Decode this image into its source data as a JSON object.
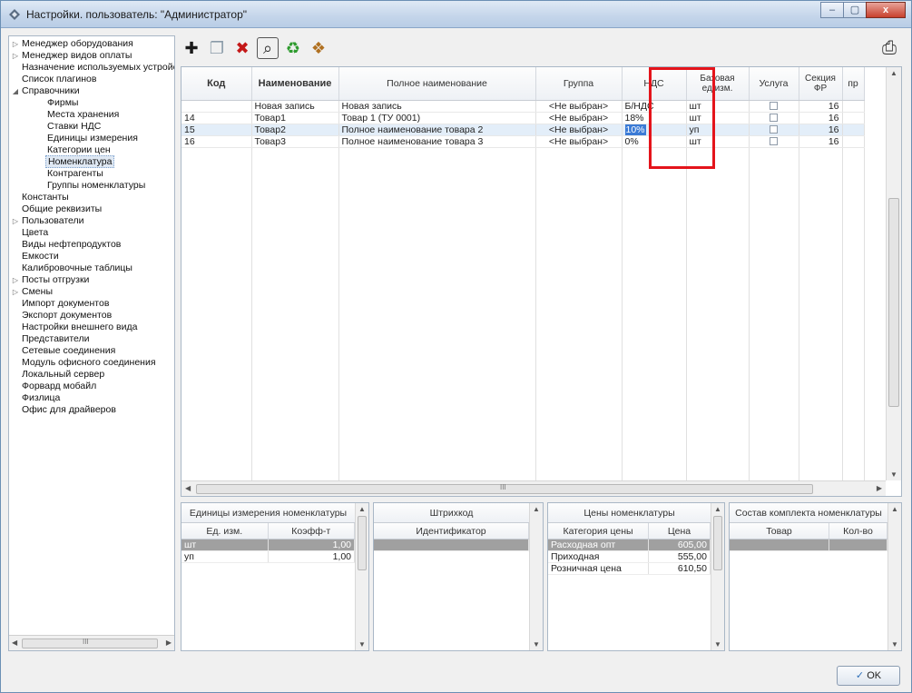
{
  "window": {
    "title": "Настройки. пользователь: \"Администратор\"",
    "min": "–",
    "max": "▢",
    "close": "x"
  },
  "tree": {
    "items": [
      {
        "label": "Менеджер оборудования",
        "expander": "▷",
        "level": 0
      },
      {
        "label": "Менеджер видов оплаты",
        "expander": "▷",
        "level": 0
      },
      {
        "label": "Назначение используемых устройств",
        "expander": "",
        "level": 0
      },
      {
        "label": "Список плагинов",
        "expander": "",
        "level": 0
      },
      {
        "label": "Справочники",
        "expander": "◢",
        "level": 0
      },
      {
        "label": "Фирмы",
        "expander": "",
        "level": 1
      },
      {
        "label": "Места хранения",
        "expander": "",
        "level": 1
      },
      {
        "label": "Ставки НДС",
        "expander": "",
        "level": 1
      },
      {
        "label": "Единицы измерения",
        "expander": "",
        "level": 1
      },
      {
        "label": "Категории цен",
        "expander": "",
        "level": 1
      },
      {
        "label": "Номенклатура",
        "expander": "",
        "level": 1,
        "selected": true
      },
      {
        "label": "Контрагенты",
        "expander": "",
        "level": 1
      },
      {
        "label": "Группы номенклатуры",
        "expander": "",
        "level": 1
      },
      {
        "label": "Константы",
        "expander": "",
        "level": 0
      },
      {
        "label": "Общие реквизиты",
        "expander": "",
        "level": 0
      },
      {
        "label": "Пользователи",
        "expander": "▷",
        "level": 0
      },
      {
        "label": "Цвета",
        "expander": "",
        "level": 0
      },
      {
        "label": "Виды нефтепродуктов",
        "expander": "",
        "level": 0
      },
      {
        "label": "Емкости",
        "expander": "",
        "level": 0
      },
      {
        "label": "Калибровочные таблицы",
        "expander": "",
        "level": 0
      },
      {
        "label": "Посты отгрузки",
        "expander": "▷",
        "level": 0
      },
      {
        "label": "Смены",
        "expander": "▷",
        "level": 0
      },
      {
        "label": "Импорт документов",
        "expander": "",
        "level": 0
      },
      {
        "label": "Экспорт документов",
        "expander": "",
        "level": 0
      },
      {
        "label": "Настройки внешнего вида",
        "expander": "",
        "level": 0
      },
      {
        "label": "Представители",
        "expander": "",
        "level": 0
      },
      {
        "label": "Сетевые соединения",
        "expander": "",
        "level": 0
      },
      {
        "label": "Модуль офисного соединения",
        "expander": "",
        "level": 0
      },
      {
        "label": "Локальный сервер",
        "expander": "",
        "level": 0
      },
      {
        "label": "Форвард мобайл",
        "expander": "",
        "level": 0
      },
      {
        "label": "Физлица",
        "expander": "",
        "level": 0
      },
      {
        "label": "Офис для драйверов",
        "expander": "",
        "level": 0
      }
    ],
    "scroll_mark": "III"
  },
  "toolbar": {
    "icons": [
      "add-icon",
      "copy-icon",
      "delete-icon",
      "search-icon",
      "refresh-icon",
      "box-icon"
    ],
    "glyphs": [
      "✚",
      "❐",
      "✖",
      "⌕",
      "♻",
      "❖"
    ],
    "right_glyph": "⎙"
  },
  "grid": {
    "columns": [
      "Код",
      "Наименование",
      "Полное наименование",
      "Группа",
      "НДС",
      "Базовая ед.изм.",
      "Услуга",
      "Секция ФР",
      "пр"
    ],
    "rows": [
      {
        "code": "",
        "name": "Новая запись",
        "full": "Новая запись",
        "group": "<Не выбран>",
        "vat": "Б/НДС",
        "unit": "шт",
        "section": "16"
      },
      {
        "code": "14",
        "name": "Товар1",
        "full": "Товар 1 (ТУ 0001)",
        "group": "<Не выбран>",
        "vat": "18%",
        "unit": "шт",
        "section": "16"
      },
      {
        "code": "15",
        "name": "Товар2",
        "full": "Полное наименование товара 2",
        "group": "<Не выбран>",
        "vat": "10%",
        "unit": "уп",
        "section": "16"
      },
      {
        "code": "16",
        "name": "Товар3",
        "full": "Полное наименование товара 3",
        "group": "<Не выбран>",
        "vat": "0%",
        "unit": "шт",
        "section": "16"
      }
    ],
    "scroll_mark": "III"
  },
  "units_panel": {
    "title": "Единицы измерения номенклатуры",
    "cols": [
      "Ед. изм.",
      "Коэфф-т"
    ],
    "rows": [
      [
        "шт",
        "1,00"
      ],
      [
        "уп",
        "1,00"
      ]
    ]
  },
  "barcode_panel": {
    "title": "Штрихкод",
    "cols": [
      "Идентификатор"
    ]
  },
  "prices_panel": {
    "title": "Цены номенклатуры",
    "cols": [
      "Категория цены",
      "Цена"
    ],
    "rows": [
      [
        "Расходная опт",
        "605,00"
      ],
      [
        "Приходная",
        "555,00"
      ],
      [
        "Розничная цена",
        "610,50"
      ]
    ]
  },
  "kit_panel": {
    "title": "Состав комплекта номенклатуры",
    "cols": [
      "Товар",
      "Кол-во"
    ]
  },
  "ok_button": {
    "label": "OK",
    "glyph": "✓"
  }
}
